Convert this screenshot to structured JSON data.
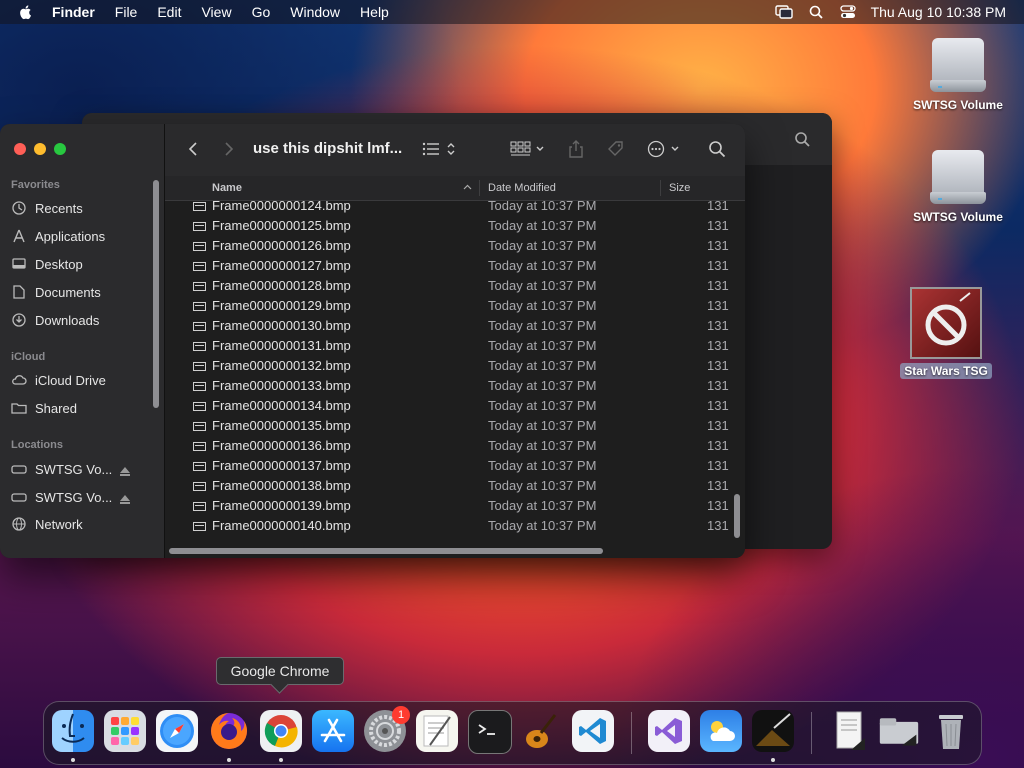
{
  "menubar": {
    "app_name": "Finder",
    "items": [
      "File",
      "Edit",
      "View",
      "Go",
      "Window",
      "Help"
    ],
    "clock": "Thu Aug 10  10:38 PM"
  },
  "desktop": {
    "icons": [
      {
        "label": "SWTSG Volume",
        "icon": "external-drive-icon"
      },
      {
        "label": "SWTSG Volume",
        "icon": "external-drive-icon"
      },
      {
        "label": "Star Wars TSG",
        "icon": "app-blocked-icon"
      }
    ]
  },
  "finder": {
    "title": "use this dipshit lmf...",
    "sidebar": {
      "favorites_header": "Favorites",
      "favorites": [
        {
          "label": "Recents",
          "icon": "clock-icon"
        },
        {
          "label": "Applications",
          "icon": "applications-icon"
        },
        {
          "label": "Desktop",
          "icon": "desktop-icon"
        },
        {
          "label": "Documents",
          "icon": "document-icon"
        },
        {
          "label": "Downloads",
          "icon": "download-icon"
        }
      ],
      "icloud_header": "iCloud",
      "icloud": [
        {
          "label": "iCloud Drive",
          "icon": "cloud-icon"
        },
        {
          "label": "Shared",
          "icon": "shared-folder-icon"
        }
      ],
      "locations_header": "Locations",
      "locations": [
        {
          "label": "SWTSG Vo...",
          "icon": "drive-icon"
        },
        {
          "label": "SWTSG Vo...",
          "icon": "drive-icon"
        },
        {
          "label": "Network",
          "icon": "globe-icon"
        }
      ]
    },
    "columns": {
      "name": "Name",
      "date": "Date Modified",
      "size": "Size"
    },
    "files": [
      {
        "name": "Frame0000000124.bmp",
        "date": "Today at 10:37 PM",
        "size": "131"
      },
      {
        "name": "Frame0000000125.bmp",
        "date": "Today at 10:37 PM",
        "size": "131"
      },
      {
        "name": "Frame0000000126.bmp",
        "date": "Today at 10:37 PM",
        "size": "131"
      },
      {
        "name": "Frame0000000127.bmp",
        "date": "Today at 10:37 PM",
        "size": "131"
      },
      {
        "name": "Frame0000000128.bmp",
        "date": "Today at 10:37 PM",
        "size": "131"
      },
      {
        "name": "Frame0000000129.bmp",
        "date": "Today at 10:37 PM",
        "size": "131"
      },
      {
        "name": "Frame0000000130.bmp",
        "date": "Today at 10:37 PM",
        "size": "131"
      },
      {
        "name": "Frame0000000131.bmp",
        "date": "Today at 10:37 PM",
        "size": "131"
      },
      {
        "name": "Frame0000000132.bmp",
        "date": "Today at 10:37 PM",
        "size": "131"
      },
      {
        "name": "Frame0000000133.bmp",
        "date": "Today at 10:37 PM",
        "size": "131"
      },
      {
        "name": "Frame0000000134.bmp",
        "date": "Today at 10:37 PM",
        "size": "131"
      },
      {
        "name": "Frame0000000135.bmp",
        "date": "Today at 10:37 PM",
        "size": "131"
      },
      {
        "name": "Frame0000000136.bmp",
        "date": "Today at 10:37 PM",
        "size": "131"
      },
      {
        "name": "Frame0000000137.bmp",
        "date": "Today at 10:37 PM",
        "size": "131"
      },
      {
        "name": "Frame0000000138.bmp",
        "date": "Today at 10:37 PM",
        "size": "131"
      },
      {
        "name": "Frame0000000139.bmp",
        "date": "Today at 10:37 PM",
        "size": "131"
      },
      {
        "name": "Frame0000000140.bmp",
        "date": "Today at 10:37 PM",
        "size": "131"
      }
    ]
  },
  "tooltip": "Google Chrome",
  "dock": {
    "items": [
      {
        "icon": "finder-icon",
        "running": true
      },
      {
        "icon": "launchpad-icon",
        "running": false
      },
      {
        "icon": "safari-icon",
        "running": false
      },
      {
        "icon": "firefox-icon",
        "running": true
      },
      {
        "icon": "chrome-icon",
        "running": true
      },
      {
        "icon": "app-store-icon",
        "running": false
      },
      {
        "icon": "system-settings-icon",
        "running": false,
        "badge": "1"
      },
      {
        "icon": "textedit-icon",
        "running": false
      },
      {
        "icon": "terminal-icon",
        "running": false
      },
      {
        "icon": "garageband-icon",
        "running": false
      },
      {
        "icon": "vscode-icon",
        "running": false
      },
      {
        "icon": "visual-studio-icon",
        "running": false
      },
      {
        "icon": "weather-icon",
        "running": false
      },
      {
        "icon": "star-wars-tsg-icon",
        "running": true
      },
      {
        "icon": "preview-document-icon",
        "running": false
      },
      {
        "icon": "folder-stack-icon",
        "running": false
      },
      {
        "icon": "trash-icon",
        "running": false
      }
    ]
  },
  "colors": {
    "accent_red": "#ff5f57",
    "accent_yellow": "#febc2e",
    "accent_green": "#28c840",
    "badge_red": "#ff3b30",
    "window_bg": "#1e1e1e",
    "sidebar_bg": "#2b2b2d"
  }
}
